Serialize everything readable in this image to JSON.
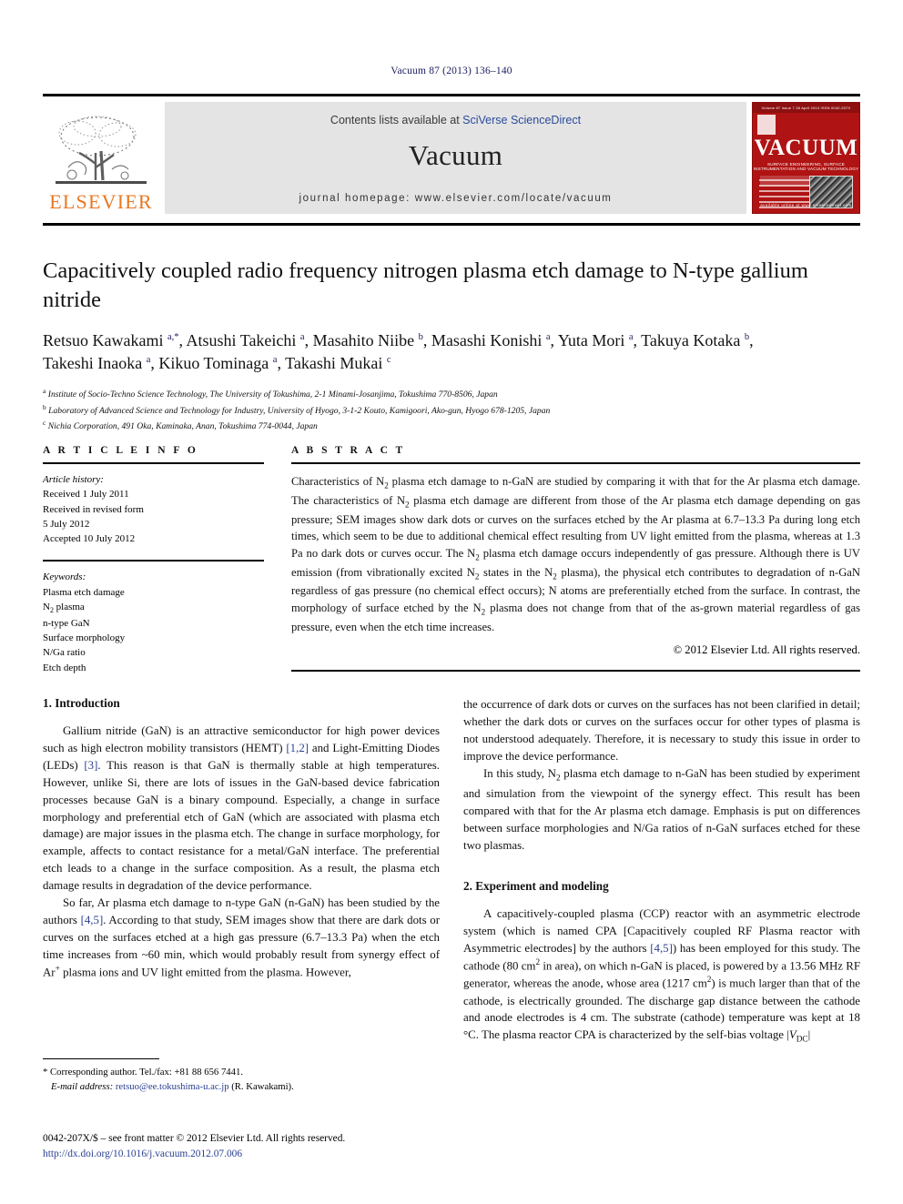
{
  "running_head": "Vacuum 87 (2013) 136–140",
  "masthead": {
    "publisher_name": "ELSEVIER",
    "contents_prefix": "Contents lists available at ",
    "sciencedirect_link": "SciVerse ScienceDirect",
    "journal_name": "Vacuum",
    "homepage": "journal homepage: www.elsevier.com/locate/vacuum",
    "cover": {
      "title": "VACUUM",
      "subtitle": "SURFACE ENGINEERING, SURFACE INSTRUMENTATION AND VACUUM TECHNOLOGY",
      "top_strip": "Volume 87   Issue 7   28 April 2013   ISSN 0042-207X",
      "footer": "available online at www.sciencedirect.com"
    }
  },
  "article": {
    "title": "Capacitively coupled radio frequency nitrogen plasma etch damage to N-type gallium nitride",
    "authors_line1": "Retsuo Kawakami a,*, Atsushi Takeichi a, Masahito Niibe b, Masashi Konishi a, Yuta Mori a, Takuya Kotaka b,",
    "authors_line2": "Takeshi Inaoka a, Kikuo Tominaga a, Takashi Mukai c",
    "affiliations": [
      "Institute of Socio-Techno Science Technology, The University of Tokushima, 2-1 Minami-Josanjima, Tokushima 770-8506, Japan",
      "Laboratory of Advanced Science and Technology for Industry, University of Hyogo, 3-1-2 Kouto, Kamigoori, Ako-gun, Hyogo 678-1205, Japan",
      "Nichia Corporation, 491 Oka, Kaminaka, Anan, Tokushima 774-0044, Japan"
    ],
    "affiliation_marks": [
      "a",
      "b",
      "c"
    ]
  },
  "article_info": {
    "heading": "A R T I C L E  I N F O",
    "history_label": "Article history:",
    "history": [
      "Received 1 July 2011",
      "Received in revised form",
      "5 July 2012",
      "Accepted 10 July 2012"
    ],
    "keywords_label": "Keywords:",
    "keywords": [
      "Plasma etch damage",
      "N2 plasma",
      "n-type GaN",
      "Surface morphology",
      "N/Ga ratio",
      "Etch depth"
    ]
  },
  "abstract": {
    "heading": "A B S T R A C T",
    "text": "Characteristics of N2 plasma etch damage to n-GaN are studied by comparing it with that for the Ar plasma etch damage. The characteristics of N2 plasma etch damage are different from those of the Ar plasma etch damage depending on gas pressure; SEM images show dark dots or curves on the surfaces etched by the Ar plasma at 6.7–13.3 Pa during long etch times, which seem to be due to additional chemical effect resulting from UV light emitted from the plasma, whereas at 1.3 Pa no dark dots or curves occur. The N2 plasma etch damage occurs independently of gas pressure. Although there is UV emission (from vibrationally excited N2 states in the N2 plasma), the physical etch contributes to degradation of n-GaN regardless of gas pressure (no chemical effect occurs); N atoms are preferentially etched from the surface. In contrast, the morphology of surface etched by the N2 plasma does not change from that of the as-grown material regardless of gas pressure, even when the etch time increases.",
    "copyright": "© 2012 Elsevier Ltd. All rights reserved."
  },
  "sections": {
    "intro_heading": "1. Introduction",
    "intro_p1": "Gallium nitride (GaN) is an attractive semiconductor for high power devices such as high electron mobility transistors (HEMT) [1,2] and Light-Emitting Diodes (LEDs) [3]. This reason is that GaN is thermally stable at high temperatures. However, unlike Si, there are lots of issues in the GaN-based device fabrication processes because GaN is a binary compound. Especially, a change in surface morphology and preferential etch of GaN (which are associated with plasma etch damage) are major issues in the plasma etch. The change in surface morphology, for example, affects to contact resistance for a metal/GaN interface. The preferential etch leads to a change in the surface composition. As a result, the plasma etch damage results in degradation of the device performance.",
    "intro_p2": "So far, Ar plasma etch damage to n-type GaN (n-GaN) has been studied by the authors [4,5]. According to that study, SEM images show that there are dark dots or curves on the surfaces etched at a high gas pressure (6.7–13.3 Pa) when the etch time increases from ~60 min, which would probably result from synergy effect of Ar+ plasma ions and UV light emitted from the plasma. However,",
    "intro_p3": "the occurrence of dark dots or curves on the surfaces has not been clarified in detail; whether the dark dots or curves on the surfaces occur for other types of plasma is not understood adequately. Therefore, it is necessary to study this issue in order to improve the device performance.",
    "intro_p4": "In this study, N2 plasma etch damage to n-GaN has been studied by experiment and simulation from the viewpoint of the synergy effect. This result has been compared with that for the Ar plasma etch damage. Emphasis is put on differences between surface morphologies and N/Ga ratios of n-GaN surfaces etched for these two plasmas.",
    "experiment_heading": "2. Experiment and modeling",
    "experiment_p1": "A capacitively-coupled plasma (CCP) reactor with an asymmetric electrode system (which is named CPA [Capacitively coupled RF Plasma reactor with Asymmetric electrodes] by the authors [4,5]) has been employed for this study. The cathode (80 cm2 in area), on which n-GaN is placed, is powered by a 13.56 MHz RF generator, whereas the anode, whose area (1217 cm2) is much larger than that of the cathode, is electrically grounded. The discharge gap distance between the cathode and anode electrodes is 4 cm. The substrate (cathode) temperature was kept at 18 °C. The plasma reactor CPA is characterized by the self-bias voltage |VDC|"
  },
  "footnote": {
    "corresponding": "* Corresponding author. Tel./fax: +81 88 656 7441.",
    "email_label": "E-mail address:",
    "email": "retsuo@ee.tokushima-u.ac.jp",
    "email_suffix": "(R. Kawakami)."
  },
  "footer": {
    "issn_line": "0042-207X/$ – see front matter © 2012 Elsevier Ltd. All rights reserved.",
    "doi": "http://dx.doi.org/10.1016/j.vacuum.2012.07.006"
  },
  "colors": {
    "elsevier_orange": "#E87722",
    "link_blue": "#2b3f8f",
    "cover_red": "#b01313",
    "banner_gray": "#e4e4e4"
  }
}
